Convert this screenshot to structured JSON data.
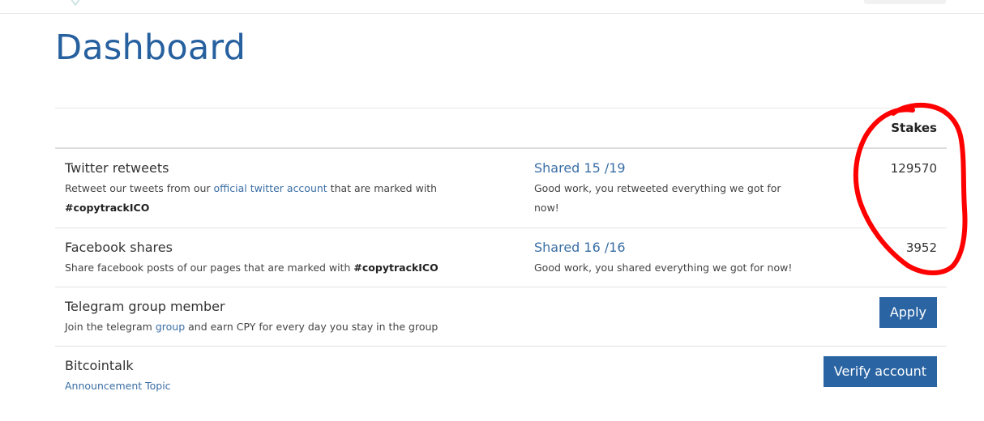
{
  "page": {
    "title": "Dashboard"
  },
  "table": {
    "stakes_header": "Stakes"
  },
  "tasks": [
    {
      "title": "Twitter retweets",
      "desc_prefix": "Retweet our tweets from our ",
      "desc_link": "official twitter account",
      "desc_suffix": " that are marked with",
      "desc_tag": "#copytrackICO",
      "status_title": "Shared 15 /19",
      "status_desc_line1": "Good work, you retweeted everything we got for",
      "status_desc_line2": "now!",
      "stakes": "129570"
    },
    {
      "title": "Facebook shares",
      "desc_prefix": "Share facebook posts of our pages that are marked with ",
      "desc_tag": "#copytrackICO",
      "status_title": "Shared 16 /16",
      "status_desc": "Good work, you shared everything we got for now!",
      "stakes": "3952"
    },
    {
      "title": "Telegram group member",
      "desc_prefix": "Join the telegram ",
      "desc_link": "group",
      "desc_suffix": " and earn CPY for every day you stay in the group",
      "button": "Apply"
    },
    {
      "title": "Bitcointalk",
      "desc_link": "Announcement Topic",
      "button": "Verify account"
    }
  ],
  "colors": {
    "title_blue": "#27609f",
    "link_blue": "#3a6ea5",
    "button_blue": "#2a64a3",
    "annotation_red": "#ff0000"
  }
}
